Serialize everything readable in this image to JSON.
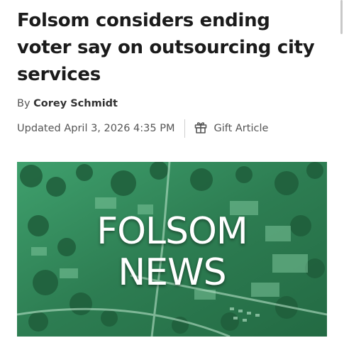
{
  "article": {
    "headline": "Folsom considers ending voter say on outsourcing city services",
    "byline_prefix": "By",
    "author": "Corey Schmidt",
    "updated": "Updated April 3, 2026 4:35 PM",
    "gift_label": "Gift Article"
  },
  "hero_image": {
    "line1": "FOLSOM",
    "line2": "NEWS",
    "tint_color": "#2f8a5c"
  },
  "icons": {
    "gift": "gift-icon"
  }
}
